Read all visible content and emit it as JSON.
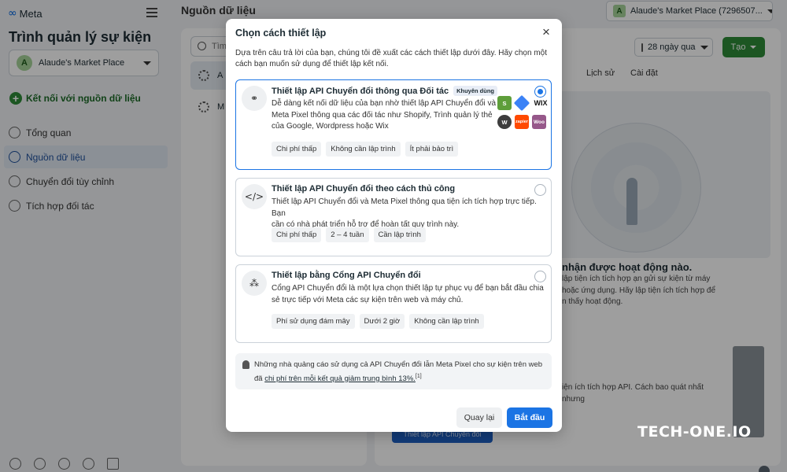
{
  "brand": {
    "name": "Meta"
  },
  "sidebar": {
    "title": "Trình quản lý sự kiện",
    "account": {
      "initial": "A",
      "name": "Alaude's Market Place"
    },
    "connect_label": "Kết nối với nguồn dữ liệu",
    "items": [
      {
        "label": "Tổng quan",
        "icon": "overview-icon",
        "active": false
      },
      {
        "label": "Nguồn dữ liệu",
        "icon": "data-sources-icon",
        "active": true
      },
      {
        "label": "Chuyển đổi tùy chỉnh",
        "icon": "custom-conversion-icon",
        "active": false
      },
      {
        "label": "Tích hợp đối tác",
        "icon": "partner-integrations-icon",
        "active": false
      }
    ]
  },
  "main": {
    "title": "Nguồn dữ liệu",
    "top_account": {
      "initial": "A",
      "name": "Alaude's Market Place (7296507..."
    },
    "search_placeholder": "Tìm",
    "source_rows": [
      {
        "label": "A"
      },
      {
        "label": "M"
      }
    ],
    "date_range": "28 ngày qua",
    "create_label": "Tạo",
    "tabs": [
      "Lịch sử",
      "Cài đặt"
    ],
    "empty_title": "nhận được hoạt động nào.",
    "empty_desc": "lập tiện ích tích hợp ạn gửi sự kiện từ máy hoặc ứng dụng. Hãy lập tiện ích tích hợp để n thấy hoạt động.",
    "lower_desc": "iện ích tích hợp API. Cách bao quát nhất nhưng",
    "lower_button": "Thiết lập API Chuyển đổi"
  },
  "dialog": {
    "title": "Chọn cách thiết lập",
    "intro": "Dựa trên câu trả lời của bạn, chúng tôi đề xuất các cách thiết lập dưới đây. Hãy chọn một cách bạn muốn sử dụng để thiết lập kết nối.",
    "options": [
      {
        "title": "Thiết lập API Chuyển đổi thông qua Đối tác",
        "badge": "Khuyên dùng",
        "desc_lines": [
          "Dễ dàng kết nối dữ liệu của bạn nhờ thiết lập API Chuyển đổi và",
          "Meta Pixel thông qua các đối tác như Shopify, Trình quản lý thẻ",
          "của Google, Wordpress hoặc Wix"
        ],
        "chips": [
          "Chi phí thấp",
          "Không cần lập trình",
          "Ít phải bảo trì"
        ],
        "selected": true
      },
      {
        "title": "Thiết lập API Chuyển đổi theo cách thủ công",
        "badge": "",
        "desc_lines": [
          "Thiết lập API Chuyển đổi và Meta Pixel thông qua tiện ích tích hợp trực tiếp. Bạn",
          "cần có nhà phát triển hỗ trợ để hoàn tất quy trình này."
        ],
        "chips": [
          "Chi phí thấp",
          "2 – 4 tuần",
          "Cần lập trình"
        ],
        "selected": false
      },
      {
        "title": "Thiết lập bằng Cổng API Chuyển đổi",
        "badge": "",
        "desc_lines": [
          "Cổng API Chuyển đổi là một lựa chọn thiết lập tự phục vụ để bạn bắt đầu chia",
          "sẻ trực tiếp với Meta các sự kiện trên web và máy chủ."
        ],
        "chips": [
          "Phí sử dụng đám mây",
          "Dưới 2 giờ",
          "Không cần lập trình"
        ],
        "selected": false
      }
    ],
    "partner_logos": [
      {
        "name": "shopify-logo",
        "text": "S"
      },
      {
        "name": "google-tag-manager-logo",
        "text": ""
      },
      {
        "name": "wix-logo",
        "text": "WIX"
      },
      {
        "name": "wordpress-logo",
        "text": "W"
      },
      {
        "name": "zapier-logo",
        "text": "zapier"
      },
      {
        "name": "woocommerce-logo",
        "text": "Woo"
      }
    ],
    "tip": {
      "text_before": "Những nhà quảng cáo sử dụng cả API Chuyển đổi lẫn Meta Pixel cho sự kiện trên web đã ",
      "link": "chi phí trên mỗi kết quả giảm trung bình 13%.",
      "sup": "[1]"
    },
    "back_label": "Quay lại",
    "start_label": "Bắt đầu"
  },
  "watermark": "TECH-ONE.IO",
  "colors": {
    "primary_blue": "#1b74e4",
    "brand_green": "#2e8c38"
  }
}
